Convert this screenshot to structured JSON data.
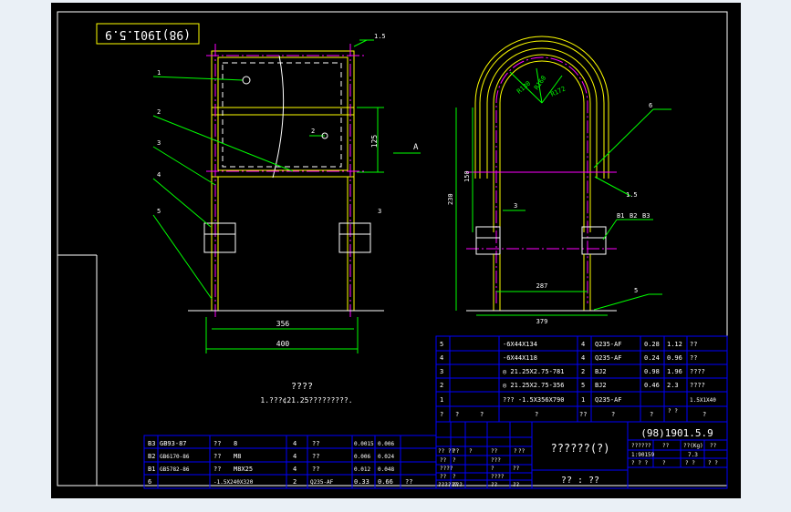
{
  "title_block_top": "(98)1901.5.9",
  "notes": {
    "heading": "????",
    "line1": "1.???¢21.25?????????."
  },
  "left_view": {
    "callouts": [
      "1",
      "2",
      "3",
      "4",
      "5"
    ],
    "dim_height": "125",
    "dim_inner_width": "356",
    "dim_outer_width": "400",
    "section_label": "A",
    "weld_labels": [
      "1.5",
      "3",
      "3"
    ],
    "detail_label": "2"
  },
  "right_view": {
    "callouts": [
      "6",
      "3",
      "5"
    ],
    "radii": [
      "R130",
      "R160",
      "R172"
    ],
    "dim_height_outer": "230",
    "dim_height_inner": "150",
    "dim_inner_width": "287",
    "dim_outer_width": "379",
    "weld_label": "1.5",
    "bolt_labels": [
      "B1",
      "B2",
      "B3"
    ]
  },
  "bom_right": [
    {
      "no": "5",
      "spec": "-6X44X134",
      "qty": "4",
      "mat": "Q235-AF",
      "w1": "0.28",
      "w2": "1.12",
      "note": "??"
    },
    {
      "no": "4",
      "spec": "-6X44X118",
      "qty": "4",
      "mat": "Q235-AF",
      "w1": "0.24",
      "w2": "0.96",
      "note": "??"
    },
    {
      "no": "3",
      "spec": "◎ 21.25X2.75-781",
      "qty": "2",
      "mat": "BJ2",
      "w1": "0.98",
      "w2": "1.96",
      "note": "????"
    },
    {
      "no": "2",
      "spec": "◎ 21.25X2.75-356",
      "qty": "5",
      "mat": "BJ2",
      "w1": "0.46",
      "w2": "2.3",
      "note": "????"
    },
    {
      "no": "1",
      "spec": "???  -1.5X356X790",
      "qty": "1",
      "mat": "Q235-AF",
      "w1": "",
      "w2": "",
      "note": "1.5X1X40"
    }
  ],
  "bom_right_header": [
    "?",
    "?",
    "?",
    "?",
    "??",
    "?",
    "?",
    "? ?",
    "?"
  ],
  "bom_right_header_sub": "? ?\n(Kg)",
  "bom_left": [
    {
      "no": "B3",
      "std": "GB93-87",
      "name": "??",
      "spec": "8",
      "qty": "4",
      "mat": "??",
      "w1": "0.0015",
      "w2": "0.006"
    },
    {
      "no": "B2",
      "std": "GB6170-86",
      "name": "??",
      "spec": "M8",
      "qty": "4",
      "mat": "??",
      "w1": "0.006",
      "w2": "0.024"
    },
    {
      "no": "B1",
      "std": "GB5782-86",
      "name": "??",
      "spec": "M8X25",
      "qty": "4",
      "mat": "??",
      "w1": "0.012",
      "w2": "0.048"
    },
    {
      "no": "6",
      "std": "",
      "name": "",
      "spec": "-1.5X240X320",
      "qty": "2",
      "mat": "Q235-AF",
      "w1": "0.33",
      "w2": "0.66",
      "note": "??"
    }
  ],
  "title_block": {
    "drawing_no": "(98)1901.5.9",
    "name": "??????(?)",
    "company": "?? : ??",
    "row1": [
      "??????",
      "??",
      "??(Kg)",
      "??"
    ],
    "row2": [
      "1:90159",
      "",
      "7.3",
      ""
    ],
    "row3": [
      "? ? ?",
      "?",
      "? ?",
      "? ?"
    ],
    "signoff": [
      "?? ??",
      "??",
      "?",
      "??",
      "?",
      "??",
      "??",
      "?",
      "???",
      "????",
      "?",
      "??",
      "??",
      "?",
      "????",
      "???",
      "??"
    ],
    "signoff_bottom": [
      "??????",
      "??"
    ]
  },
  "colors": {
    "background": "#000000",
    "frame": "#ffffff",
    "part": "#ffff00",
    "dimension": "#00ff00",
    "table": "#0000ff",
    "magenta": "#ff00ff",
    "text": "#ffffff"
  }
}
